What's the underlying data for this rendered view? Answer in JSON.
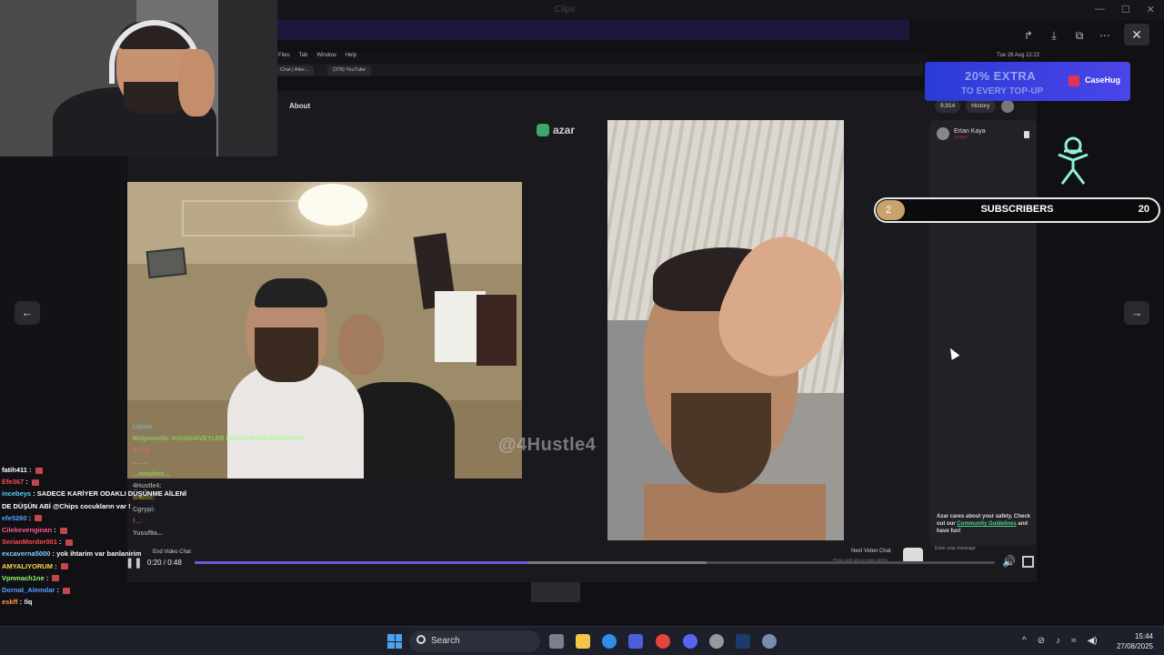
{
  "viewer": {
    "title": "Clips",
    "nav_prev": "←",
    "nav_next": "→"
  },
  "inner_app": {
    "menu_items": [
      "Files",
      "Tab",
      "Window",
      "Help"
    ],
    "clock": "Tue 26 Aug 22:22",
    "tabs": [
      "Chat | Alter...",
      "(378) YouTube"
    ],
    "about": "About",
    "brand": "azar",
    "coins": "9,914",
    "history": "History",
    "chat_user_name": "Ertan Kaya",
    "chat_user_country": "Türkiye",
    "safety_text_1": "Azar cares about your safety. Check out our",
    "safety_link": "Community Guidelines",
    "safety_text_2": "and have fun!",
    "message_placeholder": "Enter your message",
    "end_video": "End Video Chat",
    "next_video": "Next Video Chat",
    "next_hint": "Press right key to meet others"
  },
  "ad": {
    "headline": "20% EXTRA",
    "subline": "TO EVERY TOP-UP",
    "brand": "CaseHug"
  },
  "subscribers": {
    "current": "2",
    "label": "SUBSCRIBERS",
    "goal": "20",
    "progress_fraction": 0.1
  },
  "watermark": "@4Hustle4",
  "player": {
    "time": "0:20 / 0:48",
    "progress_fraction": 0.4167,
    "buffer_fraction": 0.64
  },
  "chat": [
    {
      "user": "fatih411",
      "text": "",
      "color": "#ffffff"
    },
    {
      "user": "Efe367",
      "text": "",
      "color": "#ff4b4b"
    },
    {
      "user": "incebeys",
      "text": "SADECE KARİYER ODAKLI DÜŞÜNME AİLENİ",
      "color": "#4fd0ff"
    },
    {
      "user": "",
      "text": "DE DÜŞÜN ABİ @Chips cocukların var !",
      "color": "#ffffff"
    },
    {
      "user": "efe5260",
      "text": "",
      "color": "#4fa3ff"
    },
    {
      "user": "Cilekevenginan",
      "text": "",
      "color": "#ff5a8a"
    },
    {
      "user": "SerianMorder001",
      "text": "",
      "color": "#ff4b4b"
    },
    {
      "user": "excaverna5000",
      "text": "yok ihtarim var banlanirim",
      "color": "#7fd1ff"
    },
    {
      "user": "AMYALIYORUM",
      "text": "",
      "color": "#ffd84a"
    },
    {
      "user": "Vpnmach1ne",
      "text": "",
      "color": "#8cff6a"
    },
    {
      "user": "Dornat_Alemdar",
      "text": "",
      "color": "#4fa3ff"
    },
    {
      "user": "eskff",
      "text": "!lq",
      "color": "#ff9a3d"
    }
  ],
  "faded_chat": [
    "Lazluc",
    "Belgenvelle: HAUSHAVEYLER KOBSUWJBRJUDIEHUEH",
    "4n711 ...",
    "..., ..._",
    "...nmadem...",
    "4Hustle4:",
    "bitatlic:",
    "Cgrypi:",
    "f...:",
    "Yusuf9a..."
  ],
  "taskbar": {
    "search": "Search",
    "time": "15:44",
    "date": "27/08/2025"
  },
  "colors": {
    "accent": "#6a5bd6",
    "sub_gold": "#c9a46a",
    "ad_blue": "#3b40e0",
    "azar_green": "#3da86c"
  }
}
